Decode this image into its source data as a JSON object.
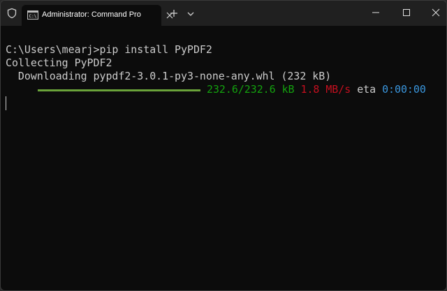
{
  "titlebar": {
    "tab_label": "Administrator: Command Pro",
    "icons": {
      "shield": "shield-icon",
      "cmd": "cmd-icon",
      "close_tab": "close-icon",
      "new_tab": "plus-icon",
      "dropdown": "chevron-down-icon",
      "minimize": "minimize-icon",
      "maximize": "maximize-icon",
      "close": "close-icon"
    }
  },
  "terminal": {
    "line1": "C:\\Users\\mearj>pip install PyPDF2",
    "line2": "Collecting PyPDF2",
    "line3": "  Downloading pypdf2-3.0.1-py3-none-any.whl (232 kB)",
    "progress": {
      "fraction": 1.0,
      "size_text": "232.6/232.6 kB",
      "speed_text": "1.8 MB/s",
      "eta_label": "eta",
      "eta_value": "0:00:00"
    },
    "colors": {
      "bar_fill": "#6ba33a",
      "size": "#13a10e",
      "speed": "#c50f1f",
      "eta": "#3a96dd",
      "text": "#cccccc",
      "background": "#0c0c0c"
    }
  }
}
